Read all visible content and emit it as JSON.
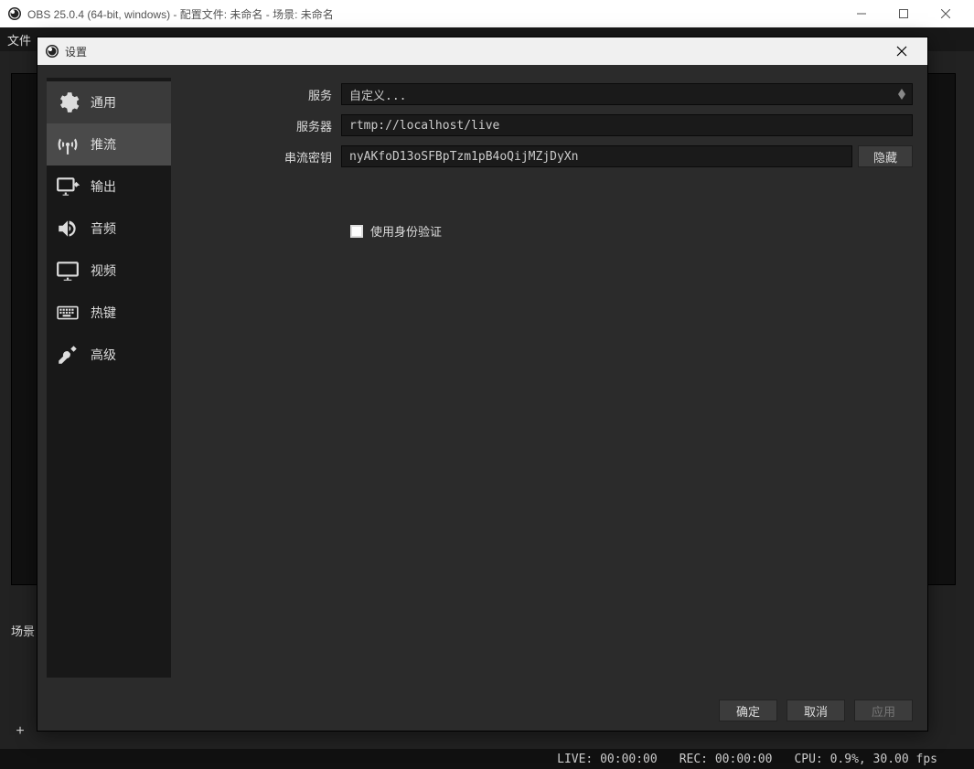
{
  "window": {
    "title": "OBS 25.0.4 (64-bit, windows) - 配置文件: 未命名 - 场景: 未命名"
  },
  "menubar": {
    "file": "文件"
  },
  "bg": {
    "scene_label": "场景",
    "add_icon": "+"
  },
  "statusbar": {
    "live": "LIVE: 00:00:00",
    "rec": "REC: 00:00:00",
    "cpu": "CPU: 0.9%, 30.00 fps"
  },
  "dialog": {
    "title": "设置",
    "sidebar": [
      {
        "key": "general",
        "label": "通用"
      },
      {
        "key": "stream",
        "label": "推流"
      },
      {
        "key": "output",
        "label": "输出"
      },
      {
        "key": "audio",
        "label": "音频"
      },
      {
        "key": "video",
        "label": "视频"
      },
      {
        "key": "hotkeys",
        "label": "热键"
      },
      {
        "key": "advanced",
        "label": "高级"
      }
    ],
    "form": {
      "service_label": "服务",
      "service_value": "自定义...",
      "server_label": "服务器",
      "server_value": "rtmp://localhost/live",
      "streamkey_label": "串流密钥",
      "streamkey_value": "nyAKfoD13oSFBpTzm1pB4oQijMZjDyXn",
      "hide_button": "隐藏",
      "use_auth_label": "使用身份验证"
    },
    "footer": {
      "ok": "确定",
      "cancel": "取消",
      "apply": "应用"
    }
  }
}
